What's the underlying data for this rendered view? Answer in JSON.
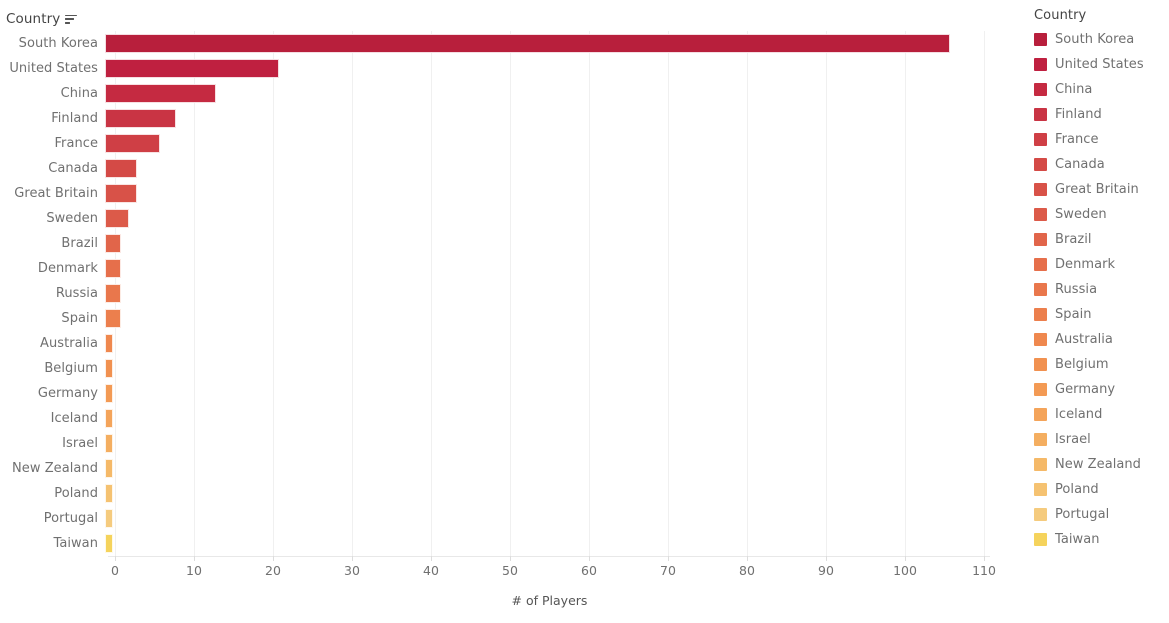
{
  "field_header": {
    "label": "Country",
    "sort_icon": "sort-descending-icon"
  },
  "legend": {
    "title": "Country"
  },
  "chart_data": {
    "type": "bar",
    "orientation": "horizontal",
    "title": "",
    "subtitle": "",
    "xlabel": "# of Players",
    "ylabel": "Country",
    "xlim": [
      0,
      110
    ],
    "xticks": [
      0,
      10,
      20,
      30,
      40,
      50,
      60,
      70,
      80,
      90,
      100,
      110
    ],
    "xtick_labels": [
      "0",
      "10",
      "20",
      "30",
      "40",
      "50",
      "60",
      "70",
      "80",
      "90",
      "100",
      "110"
    ],
    "grid": true,
    "legend_position": "right",
    "categories": [
      "South Korea",
      "United States",
      "China",
      "Finland",
      "France",
      "Canada",
      "Great Britain",
      "Sweden",
      "Brazil",
      "Denmark",
      "Russia",
      "Spain",
      "Australia",
      "Belgium",
      "Germany",
      "Iceland",
      "Israel",
      "New Zealand",
      "Poland",
      "Portugal",
      "Taiwan"
    ],
    "values": [
      107,
      22,
      14,
      9,
      7,
      4,
      4,
      3,
      2,
      2,
      2,
      2,
      1,
      1,
      1,
      1,
      1,
      1,
      1,
      1,
      1
    ],
    "colors": [
      "#b81f3c",
      "#bf2040",
      "#c52a41",
      "#c93444",
      "#cf3f45",
      "#d44a46",
      "#d85248",
      "#dc5a49",
      "#e1654a",
      "#e66f4b",
      "#e9774c",
      "#ec7f4d",
      "#ef884e",
      "#f19150",
      "#f39a54",
      "#f4a45a",
      "#f4ae60",
      "#f5b968",
      "#f5c271",
      "#f5cb7e",
      "#f5d35c"
    ],
    "legend_entries": [
      {
        "label": "South Korea",
        "color": "#b81f3c"
      },
      {
        "label": "United States",
        "color": "#bf2040"
      },
      {
        "label": "China",
        "color": "#c52a41"
      },
      {
        "label": "Finland",
        "color": "#c93444"
      },
      {
        "label": "France",
        "color": "#cf3f45"
      },
      {
        "label": "Canada",
        "color": "#d44a46"
      },
      {
        "label": "Great Britain",
        "color": "#d85248"
      },
      {
        "label": "Sweden",
        "color": "#dc5a49"
      },
      {
        "label": "Brazil",
        "color": "#e1654a"
      },
      {
        "label": "Denmark",
        "color": "#e66f4b"
      },
      {
        "label": "Russia",
        "color": "#e9774c"
      },
      {
        "label": "Spain",
        "color": "#ec7f4d"
      },
      {
        "label": "Australia",
        "color": "#ef884e"
      },
      {
        "label": "Belgium",
        "color": "#f19150"
      },
      {
        "label": "Germany",
        "color": "#f39a54"
      },
      {
        "label": "Iceland",
        "color": "#f4a45a"
      },
      {
        "label": "Israel",
        "color": "#f4ae60"
      },
      {
        "label": "New Zealand",
        "color": "#f5b968"
      },
      {
        "label": "Poland",
        "color": "#f5c271"
      },
      {
        "label": "Portugal",
        "color": "#f5cb7e"
      },
      {
        "label": "Taiwan",
        "color": "#f5d35c"
      }
    ]
  }
}
